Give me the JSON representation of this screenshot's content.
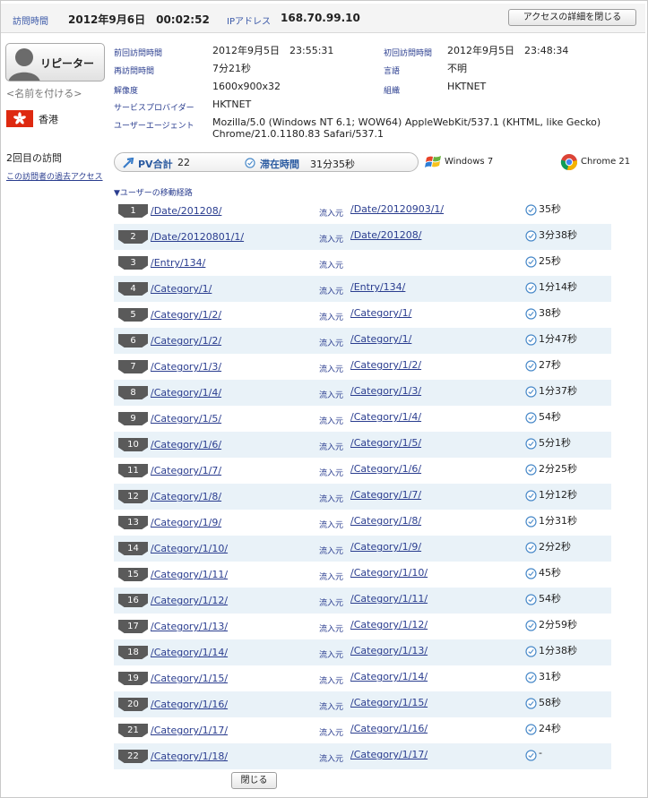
{
  "header": {
    "visit_time_label": "訪問時間",
    "visit_time_value": "2012年9月6日　00:02:52",
    "ip_label": "IPアドレス",
    "ip_value": "168.70.99.10",
    "close_details_label": "アクセスの詳細を閉じる"
  },
  "visitor": {
    "type_label": "リピーター",
    "name_link": "<名前を付ける>",
    "country": "香港",
    "visit_count": "2回目の訪問",
    "past_access_link": "この訪問者の過去アクセス"
  },
  "info": {
    "prev_visit_label": "前回訪問時間",
    "prev_visit_value": "2012年9月5日　23:55:31",
    "first_visit_label": "初回訪問時間",
    "first_visit_value": "2012年9月5日　23:48:34",
    "revisit_label": "再訪問時間",
    "revisit_value": "7分21秒",
    "language_label": "言語",
    "language_value": "不明",
    "resolution_label": "解像度",
    "resolution_value": "1600x900x32",
    "org_label": "組織",
    "org_value": "HKTNET",
    "provider_label": "サービスプロバイダー",
    "provider_value": "HKTNET",
    "ua_label": "ユーザーエージェント",
    "ua_value": "Mozilla/5.0 (Windows NT 6.1; WOW64) AppleWebKit/537.1 (KHTML, like Gecko) Chrome/21.0.1180.83 Safari/537.1"
  },
  "stats": {
    "pv_label": "PV合計",
    "pv_value": "22",
    "stay_label": "滞在時間",
    "stay_value": "31分35秒",
    "os": "Windows 7",
    "browser": "Chrome 21"
  },
  "route": {
    "title": "▼ユーザーの移動経路",
    "inflow_label": "流入元",
    "rows": [
      {
        "n": "1",
        "page": "/Date/201208/",
        "ref": "/Date/20120903/1/",
        "dur": "35秒"
      },
      {
        "n": "2",
        "page": "/Date/20120801/1/",
        "ref": "/Date/201208/",
        "dur": "3分38秒"
      },
      {
        "n": "3",
        "page": "/Entry/134/",
        "ref": "",
        "dur": "25秒"
      },
      {
        "n": "4",
        "page": "/Category/1/",
        "ref": "/Entry/134/",
        "dur": "1分14秒"
      },
      {
        "n": "5",
        "page": "/Category/1/2/",
        "ref": "/Category/1/",
        "dur": "38秒"
      },
      {
        "n": "6",
        "page": "/Category/1/2/",
        "ref": "/Category/1/",
        "dur": "1分47秒"
      },
      {
        "n": "7",
        "page": "/Category/1/3/",
        "ref": "/Category/1/2/",
        "dur": "27秒"
      },
      {
        "n": "8",
        "page": "/Category/1/4/",
        "ref": "/Category/1/3/",
        "dur": "1分37秒"
      },
      {
        "n": "9",
        "page": "/Category/1/5/",
        "ref": "/Category/1/4/",
        "dur": "54秒"
      },
      {
        "n": "10",
        "page": "/Category/1/6/",
        "ref": "/Category/1/5/",
        "dur": "5分1秒"
      },
      {
        "n": "11",
        "page": "/Category/1/7/",
        "ref": "/Category/1/6/",
        "dur": "2分25秒"
      },
      {
        "n": "12",
        "page": "/Category/1/8/",
        "ref": "/Category/1/7/",
        "dur": "1分12秒"
      },
      {
        "n": "13",
        "page": "/Category/1/9/",
        "ref": "/Category/1/8/",
        "dur": "1分31秒"
      },
      {
        "n": "14",
        "page": "/Category/1/10/",
        "ref": "/Category/1/9/",
        "dur": "2分2秒"
      },
      {
        "n": "15",
        "page": "/Category/1/11/",
        "ref": "/Category/1/10/",
        "dur": "45秒"
      },
      {
        "n": "16",
        "page": "/Category/1/12/",
        "ref": "/Category/1/11/",
        "dur": "54秒"
      },
      {
        "n": "17",
        "page": "/Category/1/13/",
        "ref": "/Category/1/12/",
        "dur": "2分59秒"
      },
      {
        "n": "18",
        "page": "/Category/1/14/",
        "ref": "/Category/1/13/",
        "dur": "1分38秒"
      },
      {
        "n": "19",
        "page": "/Category/1/15/",
        "ref": "/Category/1/14/",
        "dur": "31秒"
      },
      {
        "n": "20",
        "page": "/Category/1/16/",
        "ref": "/Category/1/15/",
        "dur": "58秒"
      },
      {
        "n": "21",
        "page": "/Category/1/17/",
        "ref": "/Category/1/16/",
        "dur": "24秒"
      },
      {
        "n": "22",
        "page": "/Category/1/18/",
        "ref": "/Category/1/17/",
        "dur": "-"
      }
    ]
  },
  "footer": {
    "close_label": "閉じる"
  },
  "icons": {
    "avatar": "person-silhouette-icon",
    "flag": "hong-kong-flag-icon",
    "pv": "arrow-icon",
    "stay": "clock-icon",
    "os": "windows-logo-icon",
    "browser": "chrome-logo-icon"
  },
  "colors": {
    "link": "#2a3d8f",
    "row_alt": "#e9f2f8",
    "badge": "#5a5a5a",
    "flag_red": "#de2910"
  }
}
